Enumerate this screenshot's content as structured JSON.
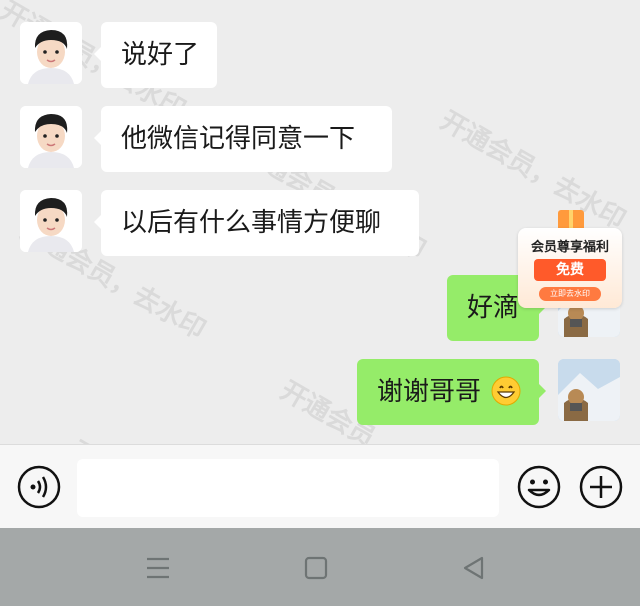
{
  "watermarks": [
    "开通会员，去水印"
  ],
  "messages": [
    {
      "side": "in",
      "avatar": "boy-avatar",
      "text": "说好了"
    },
    {
      "side": "in",
      "avatar": "boy-avatar",
      "text": "他微信记得同意一下"
    },
    {
      "side": "in",
      "avatar": "boy-avatar",
      "text": "以后有什么事情方便聊"
    },
    {
      "side": "out",
      "avatar": "fox-avatar",
      "text": "好滴"
    },
    {
      "side": "out",
      "avatar": "fox-avatar",
      "text": "谢谢哥哥",
      "emoji": "grinning-face-emoji"
    }
  ],
  "promo": {
    "title": "会员尊享福利",
    "badge": "免费",
    "link": "立即去水印"
  },
  "input": {
    "value": "",
    "placeholder": ""
  },
  "icons": {
    "voice": "voice-input-icon",
    "emoji": "emoji-icon",
    "more": "plus-icon",
    "nav_menu": "menu-icon",
    "nav_home": "home-square-icon",
    "nav_back": "back-triangle-icon"
  },
  "colors": {
    "chat_background": "#ededed",
    "incoming_bubble": "#ffffff",
    "outgoing_bubble": "#95ec69",
    "nav_bar": "#a4a8a8"
  }
}
